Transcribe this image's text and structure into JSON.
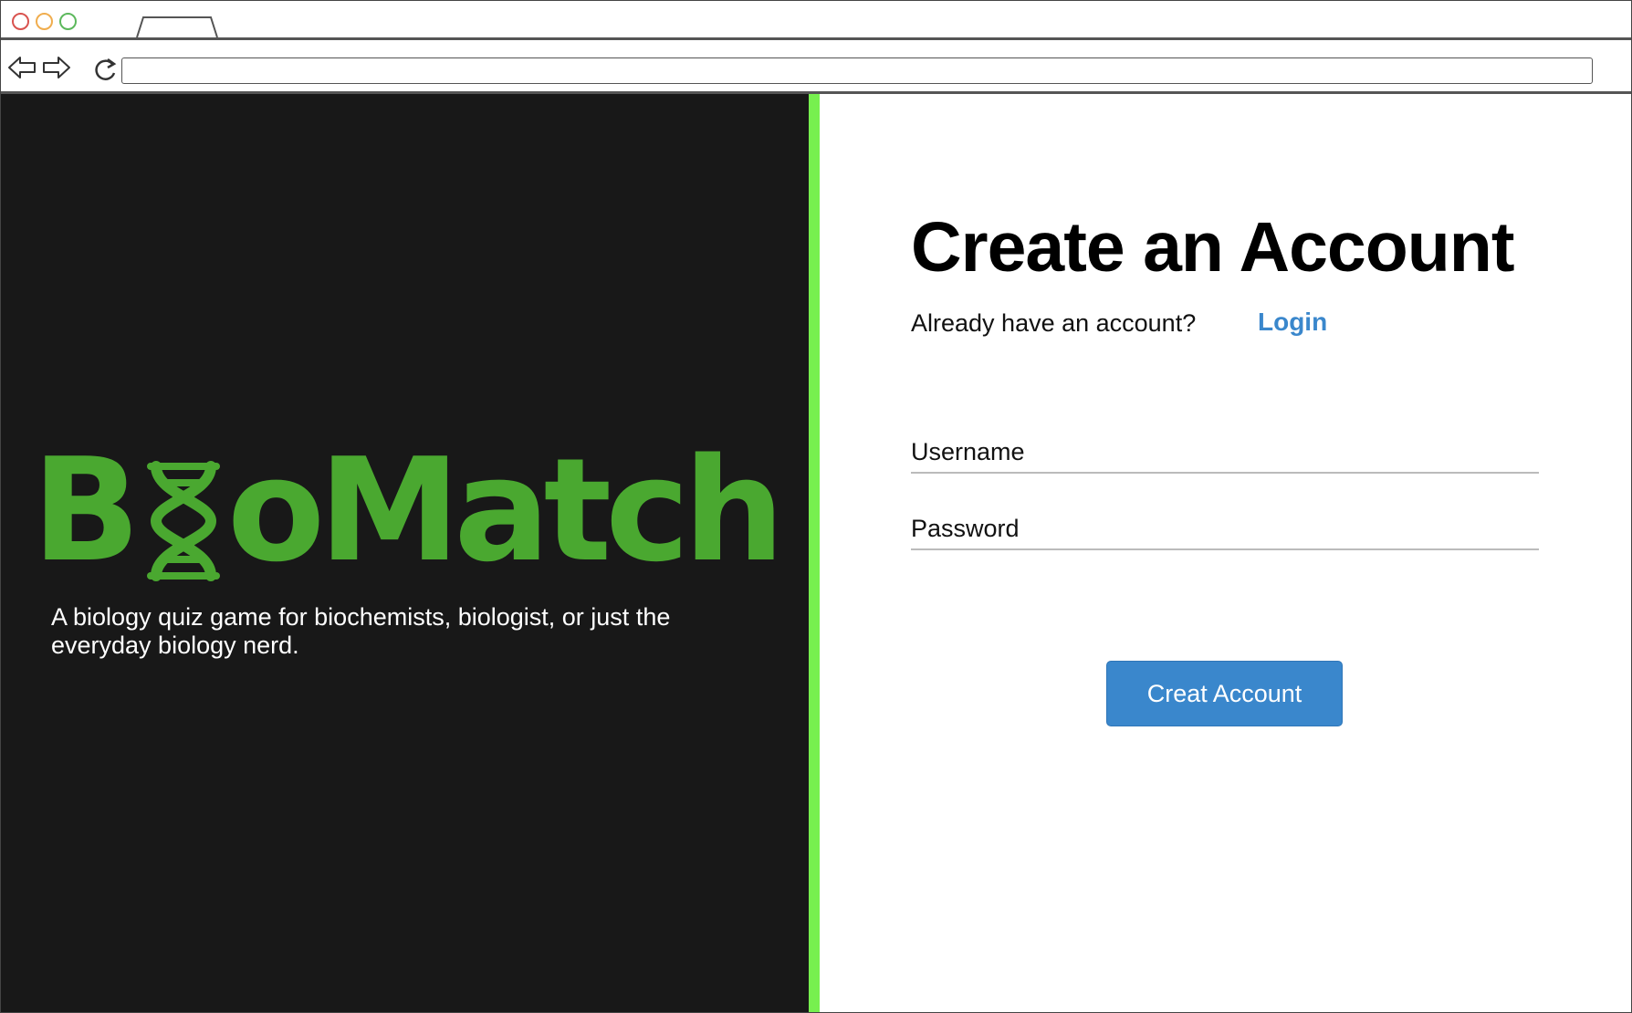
{
  "brand": {
    "logo_text": "BioMatch",
    "logo_prefix": "B",
    "logo_suffix": "oMatch",
    "tagline": "A biology quiz game for biochemists, biologist, or just the everyday biology nerd."
  },
  "form": {
    "title": "Create an Account",
    "already_prompt": "Already have an account?",
    "login_label": "Login",
    "username_label": "Username",
    "password_label": "Password",
    "submit_label": "Creat Account"
  },
  "colors": {
    "brand_green": "#4aa830",
    "divider_green": "#77f04f",
    "panel_dark": "#181818",
    "accent_blue": "#3a87cc"
  },
  "icons": {
    "back": "back-arrow-icon",
    "forward": "forward-arrow-icon",
    "reload": "reload-icon",
    "logo_i": "dna-helix-icon"
  }
}
